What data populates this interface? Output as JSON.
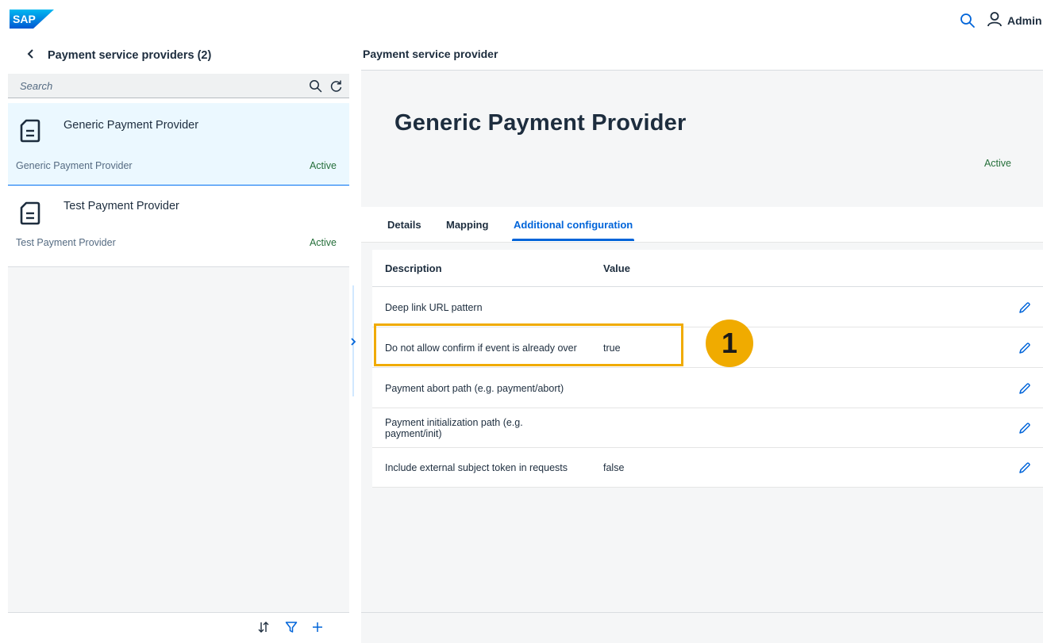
{
  "shell": {
    "logo_text": "SAP",
    "user_label": "Admin",
    "brand_color": "#0070f2"
  },
  "master": {
    "title": "Payment service providers (2)",
    "search": {
      "placeholder": "Search",
      "value": ""
    },
    "items": [
      {
        "title": "Generic Payment Provider",
        "subtitle": "Generic Payment Provider",
        "status": "Active",
        "selected": true
      },
      {
        "title": "Test Payment Provider",
        "subtitle": "Test Payment Provider",
        "status": "Active",
        "selected": false
      }
    ]
  },
  "detail": {
    "breadcrumb": "Payment service provider",
    "object_title": "Generic Payment Provider",
    "object_status": "Active",
    "tabs": [
      {
        "label": "Details"
      },
      {
        "label": "Mapping"
      },
      {
        "label": "Additional configuration",
        "active": true
      }
    ],
    "table": {
      "headers": {
        "description": "Description",
        "value": "Value"
      },
      "rows": [
        {
          "description": "Deep link URL pattern",
          "value": ""
        },
        {
          "description": "Do not allow confirm if event is already over",
          "value": "true"
        },
        {
          "description": "Payment abort path (e.g. payment/abort)",
          "value": ""
        },
        {
          "description": "Payment initialization path (e.g. payment/init)",
          "value": ""
        },
        {
          "description": "Include external subject token in requests",
          "value": "false"
        }
      ]
    }
  },
  "annotation": {
    "callout_number": "1",
    "highlight_color": "#f0ab00"
  },
  "icons": {
    "shell": [
      "search-icon",
      "user-icon"
    ],
    "master_header": [
      "back-icon"
    ],
    "search_bar": [
      "search-icon",
      "refresh-icon"
    ],
    "list_items": [
      "document-icon"
    ],
    "footer": [
      "sort-icon",
      "filter-icon",
      "add-icon"
    ],
    "rows": [
      "edit-icon"
    ]
  },
  "colors": {
    "positive_status": "#256f3a",
    "link_blue": "#0064d9",
    "selected_row_bg": "#ebf8ff"
  }
}
